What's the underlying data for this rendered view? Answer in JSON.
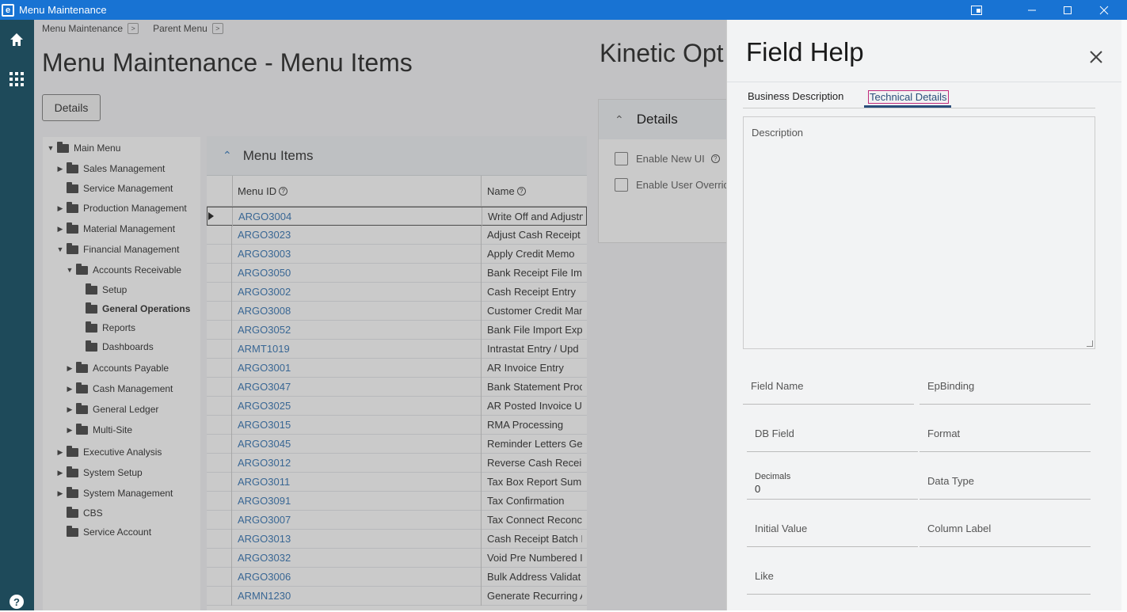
{
  "window": {
    "title": "Menu Maintenance",
    "logo": "e"
  },
  "breadcrumb": [
    "Menu Maintenance",
    "Parent Menu"
  ],
  "page": {
    "title": "Menu Maintenance - Menu Items",
    "details_button": "Details"
  },
  "tree": [
    {
      "label": "Main Menu",
      "level": 0,
      "caret": "down"
    },
    {
      "label": "Sales Management",
      "level": 1,
      "caret": "right"
    },
    {
      "label": "Service Management",
      "level": 1,
      "caret": ""
    },
    {
      "label": "Production Management",
      "level": 1,
      "caret": "right"
    },
    {
      "label": "Material Management",
      "level": 1,
      "caret": "right"
    },
    {
      "label": "Financial Management",
      "level": 1,
      "caret": "down"
    },
    {
      "label": "Accounts Receivable",
      "level": 2,
      "caret": "down"
    },
    {
      "label": "Setup",
      "level": 3,
      "caret": ""
    },
    {
      "label": "General Operations",
      "level": 3,
      "caret": "",
      "bold": true
    },
    {
      "label": "Reports",
      "level": 3,
      "caret": ""
    },
    {
      "label": "Dashboards",
      "level": 3,
      "caret": ""
    },
    {
      "label": "Accounts Payable",
      "level": 2,
      "caret": "right"
    },
    {
      "label": "Cash Management",
      "level": 2,
      "caret": "right"
    },
    {
      "label": "General Ledger",
      "level": 2,
      "caret": "right"
    },
    {
      "label": "Multi-Site",
      "level": 2,
      "caret": "right"
    },
    {
      "label": "Executive Analysis",
      "level": 1,
      "caret": "right"
    },
    {
      "label": "System Setup",
      "level": 1,
      "caret": "right"
    },
    {
      "label": "System Management",
      "level": 1,
      "caret": "right"
    },
    {
      "label": "CBS",
      "level": 1,
      "caret": ""
    },
    {
      "label": "Service Account",
      "level": 1,
      "caret": ""
    }
  ],
  "grid": {
    "title": "Menu Items",
    "columns": {
      "id": "Menu ID",
      "name": "Name"
    },
    "rows": [
      {
        "id": "ARGO3004",
        "name": "Write Off and Adjustm"
      },
      {
        "id": "ARGO3023",
        "name": "Adjust Cash Receipt"
      },
      {
        "id": "ARGO3003",
        "name": "Apply Credit Memo"
      },
      {
        "id": "ARGO3050",
        "name": "Bank Receipt File Im"
      },
      {
        "id": "ARGO3002",
        "name": "Cash Receipt Entry"
      },
      {
        "id": "ARGO3008",
        "name": "Customer Credit Man"
      },
      {
        "id": "ARGO3052",
        "name": "Bank File Import Exp"
      },
      {
        "id": "ARMT1019",
        "name": "Intrastat Entry / Upd"
      },
      {
        "id": "ARGO3001",
        "name": "AR Invoice Entry"
      },
      {
        "id": "ARGO3047",
        "name": "Bank Statement Proc"
      },
      {
        "id": "ARGO3025",
        "name": "AR Posted Invoice Up"
      },
      {
        "id": "ARGO3015",
        "name": "RMA Processing"
      },
      {
        "id": "ARGO3045",
        "name": "Reminder Letters Ge"
      },
      {
        "id": "ARGO3012",
        "name": "Reverse Cash Receip"
      },
      {
        "id": "ARGO3011",
        "name": "Tax Box Report Sumi"
      },
      {
        "id": "ARGO3091",
        "name": "Tax Confirmation"
      },
      {
        "id": "ARGO3007",
        "name": "Tax Connect Reconci"
      },
      {
        "id": "ARGO3013",
        "name": "Cash Receipt Batch M"
      },
      {
        "id": "ARGO3032",
        "name": "Void Pre Numbered I"
      },
      {
        "id": "ARGO3006",
        "name": "Bulk Address Validat"
      },
      {
        "id": "ARMN1230",
        "name": "Generate Recurring A"
      }
    ]
  },
  "kinetic": {
    "title": "Kinetic Opt",
    "details_title": "Details",
    "enable_new_ui": "Enable New UI",
    "enable_user_override": "Enable User Overrid"
  },
  "help": {
    "title": "Field Help",
    "tabs": [
      "Business Description",
      "Technical Details"
    ],
    "description_label": "Description",
    "fields": {
      "field_name": "Field Name",
      "ep_binding": "EpBinding",
      "db_field": "DB Field",
      "format": "Format",
      "decimals": "Decimals",
      "decimals_value": "0",
      "data_type": "Data Type",
      "initial_value": "Initial Value",
      "column_label": "Column Label",
      "like": "Like"
    }
  }
}
